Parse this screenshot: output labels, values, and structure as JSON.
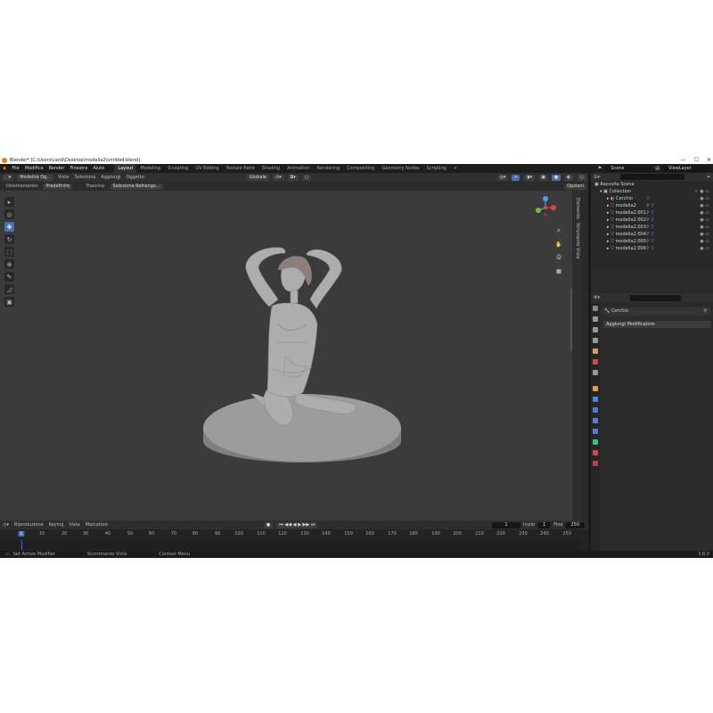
{
  "window": {
    "title": "Blender* [C:\\Users\\cardi\\Desktop\\modella2\\untitled.blend]",
    "controls": [
      "—",
      "☐",
      "✕"
    ]
  },
  "menubar": {
    "items": [
      "File",
      "Modifica",
      "Render",
      "Finestra",
      "Aiuto"
    ],
    "workspaces": [
      "Layout",
      "Modeling",
      "Sculpting",
      "UV Editing",
      "Texture Paint",
      "Shading",
      "Animation",
      "Rendering",
      "Compositing",
      "Geometry Nodes",
      "Scripting"
    ],
    "active_workspace": "Layout",
    "add_tab": "+",
    "scene": "Scene",
    "view_layer": "ViewLayer"
  },
  "viewport_header": {
    "mode": "Modalità Og...",
    "menus": [
      "Vista",
      "Seleziona",
      "Aggiungi",
      "Oggetto"
    ],
    "transform_orientation": "Globale"
  },
  "tool_header": {
    "orientation_label": "Orientamento:",
    "orientation_value": "Predefinito",
    "drag_label": "Trascina:",
    "drag_value": "Seleziona Rettango...",
    "options_label": "Opzioni"
  },
  "sidebar_tabs": [
    "Elemento",
    "Strumento",
    "Vista"
  ],
  "toolbar": {
    "tools": [
      {
        "icon": "select-box-icon",
        "active": false
      },
      {
        "icon": "cursor-icon",
        "active": false
      },
      {
        "icon": "move-icon",
        "active": true
      },
      {
        "icon": "rotate-icon",
        "active": false
      },
      {
        "icon": "scale-icon",
        "active": false
      },
      {
        "icon": "transform-icon",
        "active": false
      },
      {
        "icon": "annotate-icon",
        "active": false
      },
      {
        "icon": "measure-icon",
        "active": false
      },
      {
        "icon": "add-cube-icon",
        "active": false
      }
    ]
  },
  "gizmo": {
    "x": "X",
    "y": "Y",
    "z": "Z"
  },
  "timeline": {
    "menus": [
      "Riproduzione",
      "Keying",
      "Vista",
      "Marcatore"
    ],
    "current_frame": "1",
    "start_label": "Inizio",
    "start_value": "1",
    "end_label": "Fine",
    "end_value": "250",
    "ruler": [
      "10",
      "20",
      "30",
      "40",
      "50",
      "60",
      "70",
      "80",
      "90",
      "100",
      "110",
      "120",
      "130",
      "140",
      "150",
      "160",
      "170",
      "180",
      "190",
      "200",
      "210",
      "220",
      "230",
      "240",
      "250"
    ],
    "cursor": "1"
  },
  "statusbar": {
    "items": [
      "Set Active Modifier",
      "Scorrimento Vista",
      "Context Menu"
    ],
    "version": "3.6.0"
  },
  "outliner": {
    "root": "Raccolta Scena",
    "collection": "Collection",
    "items": [
      "Cerchio",
      "modella2",
      "modella2.001",
      "modella2.002",
      "modella2.003",
      "modella2.004",
      "modella2.005",
      "modella2.006"
    ]
  },
  "properties": {
    "object_name": "Cerchio",
    "add_modifier": "Aggiungi Modificatore"
  },
  "colors": {
    "accent": "#4772b3",
    "viewport": "#3b3b3b",
    "panel": "#2a2a2a",
    "model": "#a9a9a9"
  }
}
